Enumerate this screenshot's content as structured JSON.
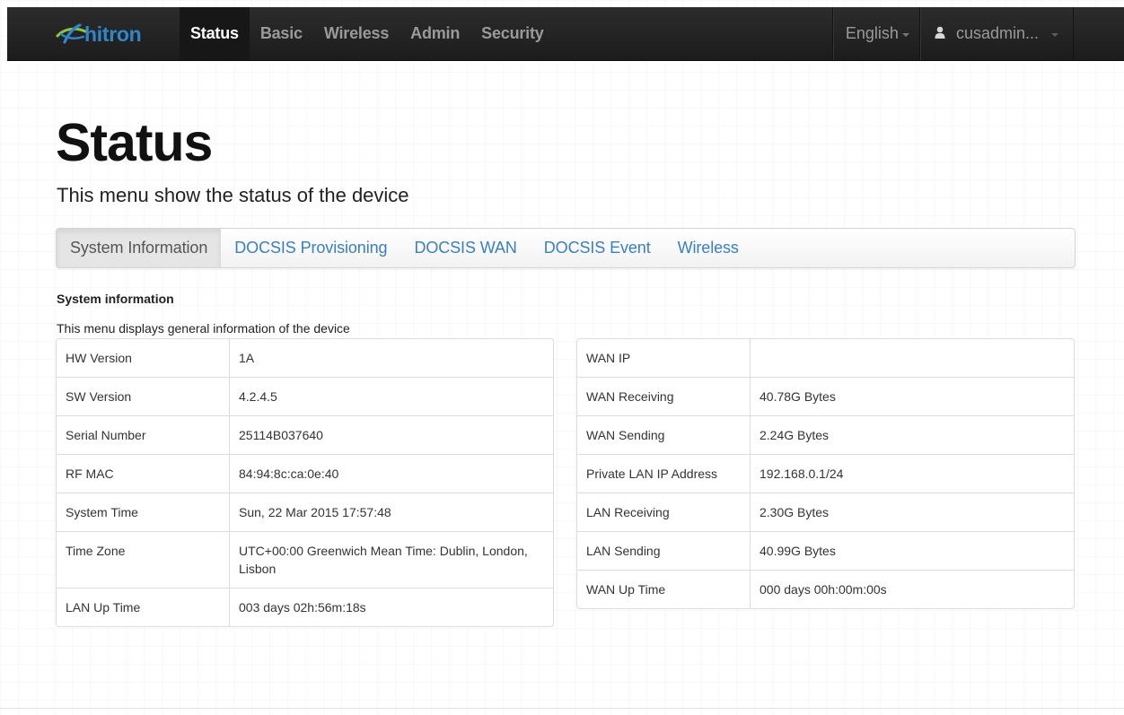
{
  "navbar": {
    "brand": "hitron",
    "items": [
      {
        "label": "Status",
        "active": true
      },
      {
        "label": "Basic",
        "active": false
      },
      {
        "label": "Wireless",
        "active": false
      },
      {
        "label": "Admin",
        "active": false
      },
      {
        "label": "Security",
        "active": false
      }
    ],
    "language": "English",
    "user": "cusadmin..."
  },
  "page": {
    "title": "Status",
    "subtitle": "This menu show the status of the device"
  },
  "tabs": [
    {
      "label": "System Information",
      "active": true
    },
    {
      "label": "DOCSIS Provisioning",
      "active": false
    },
    {
      "label": "DOCSIS WAN",
      "active": false
    },
    {
      "label": "DOCSIS Event",
      "active": false
    },
    {
      "label": "Wireless",
      "active": false
    }
  ],
  "section": {
    "heading": "System information",
    "description": "This menu displays general information of the device"
  },
  "left_table": [
    {
      "label": "HW Version",
      "value": "1A"
    },
    {
      "label": "SW Version",
      "value": "4.2.4.5"
    },
    {
      "label": "Serial Number",
      "value": "25114B037640"
    },
    {
      "label": "RF MAC",
      "value": "84:94:8c:ca:0e:40"
    },
    {
      "label": "System Time",
      "value": "Sun, 22 Mar 2015 17:57:48"
    },
    {
      "label": "Time Zone",
      "value": "UTC+00:00 Greenwich Mean Time: Dublin, London, Lisbon"
    },
    {
      "label": "LAN Up Time",
      "value": "003 days 02h:56m:18s"
    }
  ],
  "right_table": [
    {
      "label": "WAN IP",
      "value": ""
    },
    {
      "label": "WAN Receiving",
      "value": "40.78G Bytes"
    },
    {
      "label": "WAN Sending",
      "value": "2.24G Bytes"
    },
    {
      "label": "Private LAN IP Address",
      "value": "192.168.0.1/24"
    },
    {
      "label": "LAN Receiving",
      "value": "2.30G Bytes"
    },
    {
      "label": "LAN Sending",
      "value": "40.99G Bytes"
    },
    {
      "label": "WAN Up Time",
      "value": "000 days 00h:00m:00s"
    }
  ],
  "colors": {
    "navbar_bg": "#222222",
    "brand": "#2f87c9",
    "brand_leaf": "#8cc63f",
    "link": "#3a7fc1",
    "active_tab_bg": "#e5e5e5"
  },
  "icons": {
    "logo": "hitron-swoosh-icon",
    "user": "user-icon",
    "dropdown": "caret-down-icon"
  }
}
